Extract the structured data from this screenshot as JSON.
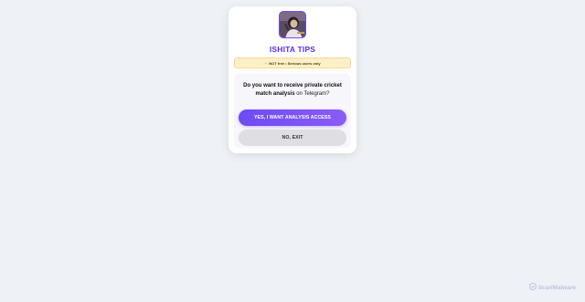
{
  "card": {
    "title": "ISHITA TIPS",
    "notice": {
      "icon": "warning-icon",
      "text": "NOT free • Serious users only"
    },
    "question": {
      "part1": "Do you want to receive ",
      "bold": "private cricket match analysis",
      "part2": " on Telegram?"
    },
    "yes_button": "YES, I WANT ANALYSIS ACCESS",
    "no_button": "NO, EXIT"
  },
  "watermark": {
    "text": "ScanMalware",
    "icon": "scanmalware-logo-icon"
  },
  "colors": {
    "accent": "#6d4bf4",
    "title": "#5b2fe0",
    "notice_bg": "#fdf0c8",
    "page_bg": "#eef1f5"
  }
}
